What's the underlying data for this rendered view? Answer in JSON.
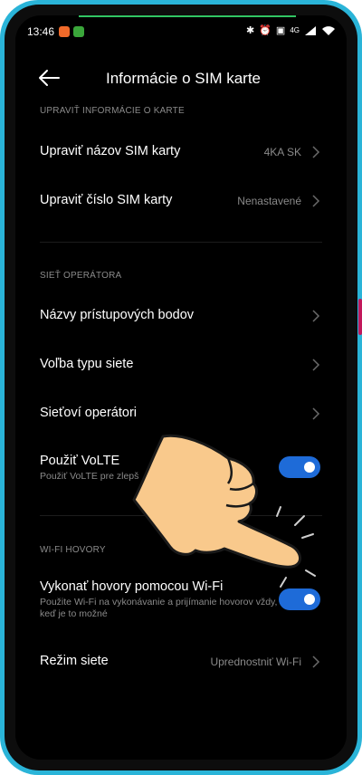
{
  "status_bar": {
    "time": "13:46",
    "network": "4G"
  },
  "header": {
    "title": "Informácie o SIM karte",
    "back_icon": "arrow-left-icon"
  },
  "sections": [
    {
      "heading": "UPRAVIŤ INFORMÁCIE O KARTE"
    },
    {
      "heading": "SIEŤ OPERÁTORA"
    },
    {
      "heading": "WI-FI HOVORY"
    }
  ],
  "rows": {
    "edit_name": {
      "label": "Upraviť názov SIM karty",
      "value": "4KA SK"
    },
    "edit_number": {
      "label": "Upraviť číslo SIM karty",
      "value": "Nenastavené"
    },
    "apn": {
      "label": "Názvy prístupových bodov"
    },
    "network_type": {
      "label": "Voľba typu siete"
    },
    "operators": {
      "label": "Sieťoví operátori"
    },
    "volte": {
      "label": "Použiť VoLTE",
      "sub": "Použiť VoLTE pre zlepš",
      "enabled": true
    },
    "wifi_calls": {
      "label": "Vykonať hovory pomocou Wi-Fi",
      "sub": "Použite Wi-Fi na vykonávanie a prijímanie hovorov vždy, keď je to možné",
      "enabled": true
    },
    "network_mode": {
      "label": "Režim siete",
      "value": "Uprednostniť Wi-Fi"
    }
  },
  "colors": {
    "toggle_on": "#1e6bd8",
    "frame": "#2ab4d8",
    "background": "#000000"
  }
}
